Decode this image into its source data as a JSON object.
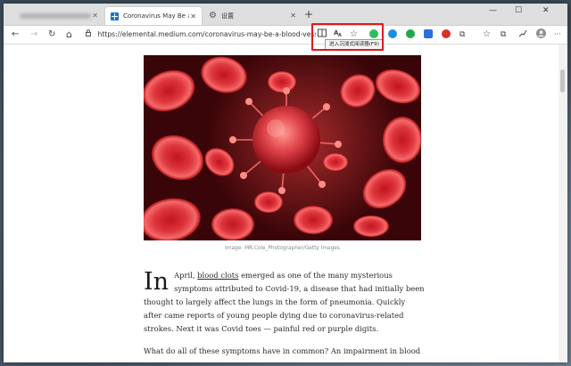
{
  "tabs": [
    {
      "label": ""
    },
    {
      "label": "Coronavirus May Be a Vascular Disease"
    },
    {
      "label": "设置"
    }
  ],
  "address_bar": {
    "url": "https://elemental.medium.com/coronavirus-may-be-a-blood-vessel-dis..."
  },
  "tooltip": "进入沉浸式阅读器(F9)",
  "article": {
    "caption": "Image: MR.Cole_Photographer/Getty Images",
    "dropcap": "In",
    "p1_before_link": "April, ",
    "p1_link": "blood clots",
    "p1_after_link": " emerged as one of the many mysterious symptoms attributed to Covid-19, a disease that had initially been thought to largely affect the lungs in the form of pneumonia. Quickly after came reports of young people dying due to coronavirus-related strokes. Next it was Covid toes — painful red or purple digits.",
    "p2": "What do all of these symptoms have in common? An impairment in blood"
  },
  "colors": {
    "highlight": "#e0191f",
    "tab_favicon": "#1a73c8",
    "ext_edge": "#1c8fe3",
    "ext_evernote": "#2dbe60",
    "ext_check": "#20a84a",
    "ext_red": "#d93025"
  },
  "icons": {
    "back": "←",
    "forward": "→",
    "refresh": "↻",
    "home": "⌂",
    "lock": "🔒",
    "immersive_reader": "📖",
    "read_aloud": "A",
    "favorite": "☆",
    "collections": "⧉",
    "profile": "●",
    "more": "···",
    "new_tab": "+",
    "minimize": "—",
    "maximize": "☐",
    "close": "✕",
    "gear": "⚙"
  }
}
